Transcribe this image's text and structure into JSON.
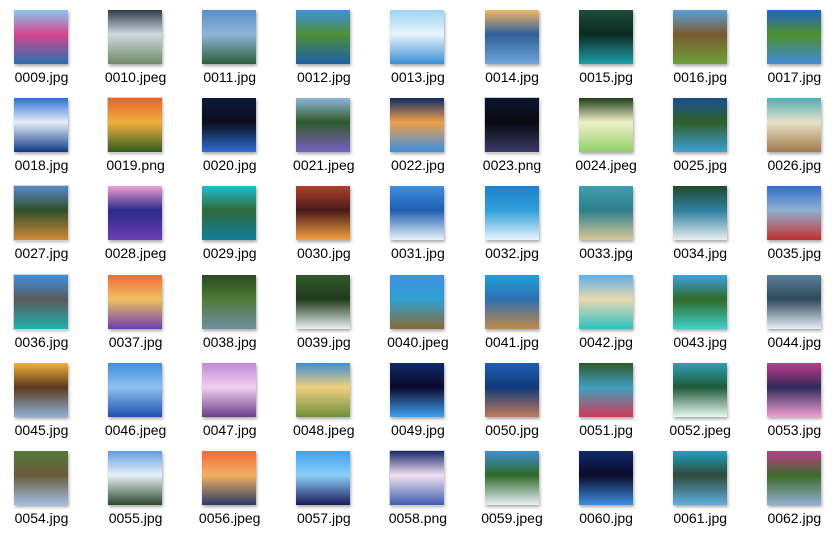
{
  "files": [
    {
      "name": "0009.jpg",
      "colors": [
        "#8ac7ef",
        "#2a6fb0",
        "#d4468f"
      ]
    },
    {
      "name": "0010.jpeg",
      "colors": [
        "#2f3d4a",
        "#6f8a6a",
        "#cfd8df"
      ]
    },
    {
      "name": "0011.jpg",
      "colors": [
        "#5a8fc9",
        "#2d5e3a",
        "#8fb5d6"
      ]
    },
    {
      "name": "0012.jpg",
      "colors": [
        "#3d8fe0",
        "#1f5fa3",
        "#4e8f3a"
      ]
    },
    {
      "name": "0013.jpg",
      "colors": [
        "#9ed4f5",
        "#3b8fd6",
        "#e8f4fb"
      ]
    },
    {
      "name": "0014.jpg",
      "colors": [
        "#f2b766",
        "#6fa6d8",
        "#2f5f99"
      ]
    },
    {
      "name": "0015.jpg",
      "colors": [
        "#1e4d3a",
        "#1f9fa7",
        "#0c2a22"
      ]
    },
    {
      "name": "0016.jpg",
      "colors": [
        "#5aa0d9",
        "#6d9f3b",
        "#7a5a2f"
      ]
    },
    {
      "name": "0017.jpg",
      "colors": [
        "#1f63c9",
        "#3f8bd6",
        "#4f8f2e"
      ]
    },
    {
      "name": "0018.jpg",
      "colors": [
        "#2c6fd4",
        "#0f3b84",
        "#e6eef8"
      ]
    },
    {
      "name": "0019.png",
      "colors": [
        "#e2642a",
        "#2f5a1f",
        "#f0b03c"
      ]
    },
    {
      "name": "0020.jpg",
      "colors": [
        "#0a1a3a",
        "#2f6fd0",
        "#0c0c1c"
      ]
    },
    {
      "name": "0021.jpeg",
      "colors": [
        "#8fb6d8",
        "#7a5fc2",
        "#2f5a2a"
      ]
    },
    {
      "name": "0022.jpg",
      "colors": [
        "#0f2a66",
        "#3b8fe0",
        "#f0a04a"
      ]
    },
    {
      "name": "0023.png",
      "colors": [
        "#0c1430",
        "#3a3a6a",
        "#0a0a10"
      ]
    },
    {
      "name": "0024.jpeg",
      "colors": [
        "#1f3f1a",
        "#8fd06a",
        "#f2f0c8"
      ]
    },
    {
      "name": "0025.jpg",
      "colors": [
        "#1a4f8f",
        "#3f9fd6",
        "#2f5f2a"
      ]
    },
    {
      "name": "0026.jpg",
      "colors": [
        "#4fb0b8",
        "#a07a4a",
        "#e8e0c8"
      ]
    },
    {
      "name": "0027.jpg",
      "colors": [
        "#5a8ac9",
        "#d08a3a",
        "#2f4f2a"
      ]
    },
    {
      "name": "0028.jpeg",
      "colors": [
        "#f0a0d0",
        "#6a3fb0",
        "#2a2a8a"
      ]
    },
    {
      "name": "0029.jpg",
      "colors": [
        "#1fbfd0",
        "#0f7f9a",
        "#2f6a3a"
      ]
    },
    {
      "name": "0030.jpg",
      "colors": [
        "#b0402a",
        "#f2a040",
        "#4a1a1a"
      ]
    },
    {
      "name": "0031.jpg",
      "colors": [
        "#3f8fe0",
        "#e8f2fa",
        "#1f5fb0"
      ]
    },
    {
      "name": "0032.jpg",
      "colors": [
        "#1f7fd0",
        "#e8f4fc",
        "#2fa0d8"
      ]
    },
    {
      "name": "0033.jpg",
      "colors": [
        "#3fa0b0",
        "#d8c89a",
        "#2f7f8a"
      ]
    },
    {
      "name": "0034.jpg",
      "colors": [
        "#1f4a2a",
        "#e8f0f0",
        "#2f7fa0"
      ]
    },
    {
      "name": "0035.jpg",
      "colors": [
        "#2f6fd0",
        "#c03030",
        "#8fb0d0"
      ]
    },
    {
      "name": "0036.jpg",
      "colors": [
        "#3f8fe0",
        "#1fb0b0",
        "#5a5a5a"
      ]
    },
    {
      "name": "0037.jpg",
      "colors": [
        "#f26a3a",
        "#6a3fb0",
        "#f0c060"
      ]
    },
    {
      "name": "0038.jpg",
      "colors": [
        "#2a4a1f",
        "#6f8fa0",
        "#4f7a3a"
      ]
    },
    {
      "name": "0039.jpg",
      "colors": [
        "#2f5a2a",
        "#e8f0f0",
        "#1f3a1a"
      ]
    },
    {
      "name": "0040.jpeg",
      "colors": [
        "#3f8fe0",
        "#8a6a3a",
        "#2fa0d0"
      ]
    },
    {
      "name": "0041.jpg",
      "colors": [
        "#1fa0d8",
        "#c08a4a",
        "#2f6fb0"
      ]
    },
    {
      "name": "0042.jpg",
      "colors": [
        "#5fb0e8",
        "#2fc0c0",
        "#e8d8b0"
      ]
    },
    {
      "name": "0043.jpg",
      "colors": [
        "#3fa0e0",
        "#3fd0c8",
        "#2f6a2a"
      ]
    },
    {
      "name": "0044.jpg",
      "colors": [
        "#5a7f9a",
        "#e8f0f8",
        "#2f4a5a"
      ]
    },
    {
      "name": "0045.jpg",
      "colors": [
        "#f2b03a",
        "#8fb0d8",
        "#5a3a1a"
      ]
    },
    {
      "name": "0046.jpeg",
      "colors": [
        "#3f8fe0",
        "#1f4fb0",
        "#8fc0f0"
      ]
    },
    {
      "name": "0047.jpg",
      "colors": [
        "#c08ad8",
        "#6a3f8a",
        "#f0d0f0"
      ]
    },
    {
      "name": "0048.jpeg",
      "colors": [
        "#3f8fd0",
        "#6f8f3a",
        "#f0d080"
      ]
    },
    {
      "name": "0049.jpg",
      "colors": [
        "#0f2a6a",
        "#3fa0f0",
        "#0a0a2a"
      ]
    },
    {
      "name": "0050.jpg",
      "colors": [
        "#1f5fb0",
        "#c07a5a",
        "#0f3a7a"
      ]
    },
    {
      "name": "0051.jpg",
      "colors": [
        "#2f5a2a",
        "#d03a5a",
        "#3fa0c0"
      ]
    },
    {
      "name": "0052.jpeg",
      "colors": [
        "#2fa0b0",
        "#e8f8f0",
        "#1f5a3a"
      ]
    },
    {
      "name": "0053.jpg",
      "colors": [
        "#c03a8a",
        "#f0a0d0",
        "#2f2a5a"
      ]
    },
    {
      "name": "0054.jpg",
      "colors": [
        "#4f7a3a",
        "#a0c0e0",
        "#6a5a3a"
      ]
    },
    {
      "name": "0055.jpg",
      "colors": [
        "#5fa0e0",
        "#2a4a2a",
        "#e8f0f8"
      ]
    },
    {
      "name": "0056.jpeg",
      "colors": [
        "#f26a3a",
        "#2a3a6a",
        "#f0b060"
      ]
    },
    {
      "name": "0057.jpg",
      "colors": [
        "#3fa0f0",
        "#1a1a5a",
        "#8ad0f8"
      ]
    },
    {
      "name": "0058.png",
      "colors": [
        "#1a2a6a",
        "#3f5fb0",
        "#f0e0f0"
      ]
    },
    {
      "name": "0059.jpeg",
      "colors": [
        "#3f8fd0",
        "#e8f0f8",
        "#2f6a2a"
      ]
    },
    {
      "name": "0060.jpg",
      "colors": [
        "#0f2a6a",
        "#3f8fe0",
        "#0a0a2a"
      ]
    },
    {
      "name": "0061.jpg",
      "colors": [
        "#1fa0c0",
        "#5fb0e0",
        "#2f4a3a"
      ]
    },
    {
      "name": "0062.jpg",
      "colors": [
        "#c03a8a",
        "#8fb0d0",
        "#3f6a2a"
      ]
    }
  ]
}
